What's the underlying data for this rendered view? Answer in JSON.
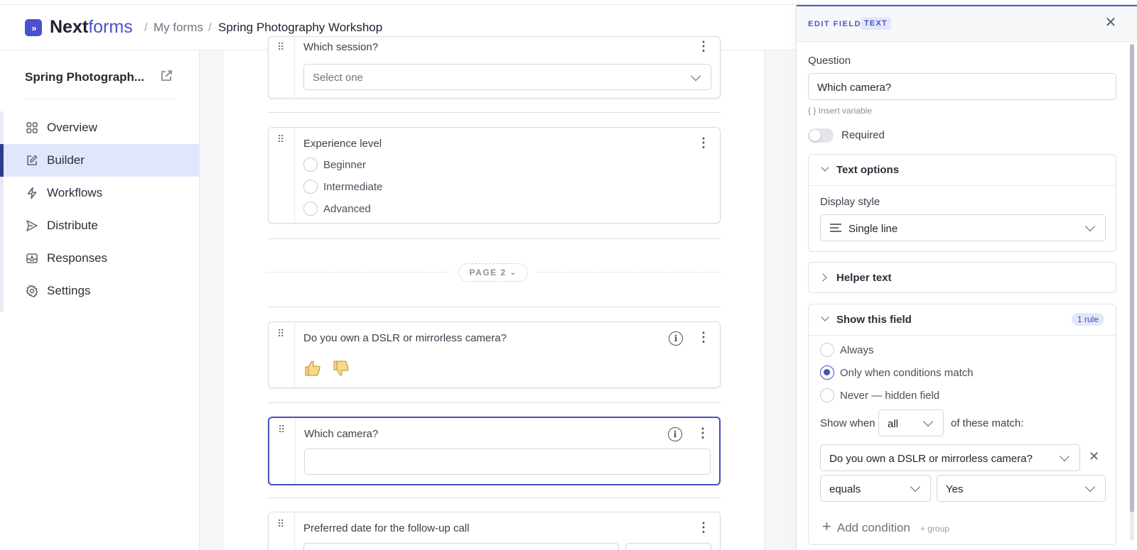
{
  "header": {
    "logo_bold": "Next",
    "logo_light": "forms",
    "breadcrumb": [
      "My forms",
      "Spring Photography Workshop"
    ],
    "separator": "/"
  },
  "sidebar": {
    "form_title": "Spring Photograph...",
    "items": [
      {
        "label": "Overview",
        "icon": "grid-icon",
        "active": false
      },
      {
        "label": "Builder",
        "icon": "edit-icon",
        "active": true
      },
      {
        "label": "Workflows",
        "icon": "lightning-icon",
        "active": false
      },
      {
        "label": "Distribute",
        "icon": "send-icon",
        "active": false
      },
      {
        "label": "Responses",
        "icon": "inbox-icon",
        "active": false
      },
      {
        "label": "Settings",
        "icon": "gear-icon",
        "active": false
      }
    ]
  },
  "canvas": {
    "session_question": "Which session?",
    "session_placeholder": "Select one",
    "experience_question": "Experience level",
    "experience_options": [
      "Beginner",
      "Intermediate",
      "Advanced"
    ],
    "page_break_label": "PAGE 2",
    "dslr_question": "Do you own a DSLR or mirrorless camera?",
    "camera_question": "Which camera?",
    "followup_question": "Preferred date for the follow-up call"
  },
  "panel": {
    "header_label": "EDIT FIELD",
    "type_badge": "TEXT",
    "question_label": "Question",
    "question_value": "Which camera?",
    "insert_variable": "{ } Insert variable",
    "required_label": "Required",
    "text_options_title": "Text options",
    "display_style_label": "Display style",
    "display_style_value": "Single line",
    "helper_text_title": "Helper text",
    "show_field_title": "Show this field",
    "rule_badge": "1 rule",
    "visibility_options": [
      "Always",
      "Only when conditions match",
      "Never — hidden field"
    ],
    "selected_visibility": 1,
    "show_when_label": "Show when",
    "match_mode": "all",
    "of_these_match": "of these match:",
    "condition_field": "Do you own a DSLR or mirrorless camera?",
    "condition_operator": "equals",
    "condition_value": "Yes",
    "add_condition": "Add condition",
    "add_group": "+ group"
  },
  "colors": {
    "accent": "#4352b8",
    "brand": "#4b4fd0",
    "active_nav_bg": "#e1e7fb"
  }
}
